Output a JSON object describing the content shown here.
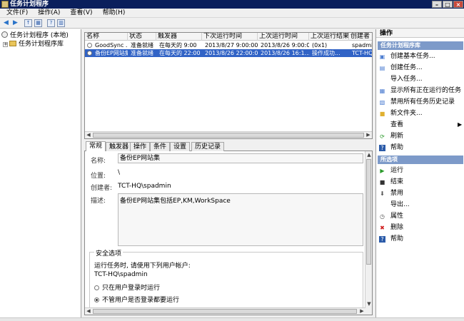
{
  "window": {
    "title": "任务计划程序",
    "buttons": [
      "–",
      "□",
      "×"
    ]
  },
  "menu": [
    {
      "label": "文件(F)"
    },
    {
      "label": "操作(A)"
    },
    {
      "label": "查看(V)"
    },
    {
      "label": "帮助(H)"
    }
  ],
  "toolbar": {
    "back_icon": "◀",
    "forward_icon": "▶",
    "up_icon": "↑",
    "show_icon": "▦",
    "help_icon": "?",
    "panel_icon": "▥"
  },
  "tree": {
    "root": "任务计划程序 (本地)",
    "child": "任务计划程序库"
  },
  "task_list": {
    "columns": [
      "名称",
      "状态",
      "触发器",
      "下次运行时间",
      "上次运行时间",
      "上次运行结果",
      "创建者"
    ],
    "rows": [
      {
        "name": "GoodSync ...",
        "status": "准备就绪",
        "trigger": "在每天的 9:00",
        "next_run": "2013/8/27 9:00:00",
        "last_run": "2013/8/26 9:00:00",
        "last_result": "(0x1)",
        "author": "spadmin"
      },
      {
        "name": "备份EP网站集",
        "status": "准备就绪",
        "trigger": "在每天的 22:00",
        "next_run": "2013/8/26 22:00:00",
        "last_run": "2013/8/26 16:1...",
        "last_result": "操作成功...",
        "author": "TCT-HQ\\sp"
      }
    ]
  },
  "detail_tabs": [
    "常规",
    "触发器",
    "操作",
    "条件",
    "设置",
    "历史记录"
  ],
  "general": {
    "name_label": "名称:",
    "name_value": "备份EP网站集",
    "location_label": "位置:",
    "location_value": "\\",
    "author_label": "创建者:",
    "author_value": "TCT-HQ\\spadmin",
    "description_label": "描述:",
    "description_value": "备份EP网站集包括EP,KM,WorkSpace",
    "security_legend": "安全选项",
    "run_as_text": "运行任务时, 请使用下列用户帐户:",
    "run_as_user": "TCT-HQ\\spadmin",
    "radio_logged_on": "只在用户登录时运行",
    "radio_whether_logged_on": "不管用户是否登录都要运行"
  },
  "actions_pane": {
    "title": "操作",
    "section_library": "任务计划程序库",
    "library_items": [
      {
        "label": "创建基本任务...",
        "icon": "task-basic-icon",
        "glyph": "▣"
      },
      {
        "label": "创建任务...",
        "icon": "task-create-icon",
        "glyph": "▤"
      },
      {
        "label": "导入任务...",
        "icon": "",
        "glyph": ""
      },
      {
        "label": "显示所有正在运行的任务",
        "icon": "running-tasks-icon",
        "glyph": "▦"
      },
      {
        "label": "禁用所有任务历史记录",
        "icon": "history-icon",
        "glyph": "▧"
      },
      {
        "label": "新文件夹...",
        "icon": "folder-icon",
        "glyph": "■"
      },
      {
        "label": "查看",
        "icon": "",
        "glyph": "",
        "submenu": "▶"
      },
      {
        "label": "刷新",
        "icon": "refresh-icon",
        "glyph": "⟳"
      },
      {
        "label": "帮助",
        "icon": "help-icon",
        "glyph": "?"
      }
    ],
    "section_selected": "所选项",
    "selected_items": [
      {
        "label": "运行",
        "icon": "run-icon",
        "glyph": "▶"
      },
      {
        "label": "结束",
        "icon": "stop-icon",
        "glyph": "■"
      },
      {
        "label": "禁用",
        "icon": "disable-icon",
        "glyph": "⬇"
      },
      {
        "label": "导出...",
        "icon": "",
        "glyph": ""
      },
      {
        "label": "属性",
        "icon": "properties-icon",
        "glyph": "◷"
      },
      {
        "label": "删除",
        "icon": "delete-icon",
        "glyph": "✖"
      },
      {
        "label": "帮助",
        "icon": "help-icon",
        "glyph": "?"
      }
    ]
  },
  "colors": {
    "title_bar": "#0a1f5c",
    "selected_row": "#3163c6",
    "section_header": "#7d9ac9",
    "delete_icon": "#d02020",
    "run_icon": "#2a9a2a"
  }
}
